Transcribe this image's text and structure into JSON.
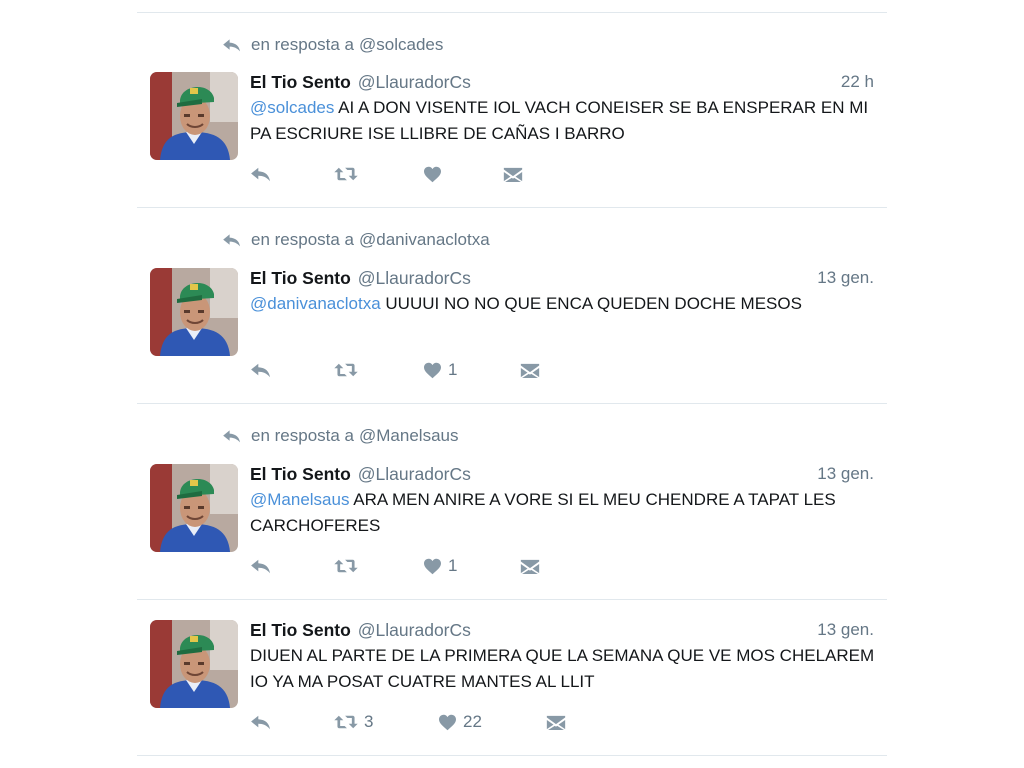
{
  "tweets": [
    {
      "reply_prefix": "en resposta a",
      "reply_handle": "@solcades",
      "name": "El Tio Sento",
      "screen_name": "@LlauradorCs",
      "time": "22 h",
      "mention": "@solcades",
      "text": " AI A DON VISENTE IOL VACH CONEISER SE BA ENSPERAR EN MI PA ESCRIURE ISE LLIBRE DE CAÑAS I BARRO",
      "retweets": "",
      "likes": ""
    },
    {
      "reply_prefix": "en resposta a",
      "reply_handle": "@danivanaclotxa",
      "name": "El Tio Sento",
      "screen_name": "@LlauradorCs",
      "time": "13 gen.",
      "mention": "@danivanaclotxa",
      "text": " UUUUI NO NO QUE ENCA QUEDEN DOCHE MESOS",
      "retweets": "",
      "likes": "1"
    },
    {
      "reply_prefix": "en resposta a",
      "reply_handle": "@Manelsaus",
      "name": "El Tio Sento",
      "screen_name": "@LlauradorCs",
      "time": "13 gen.",
      "mention": "@Manelsaus",
      "text": " ARA MEN ANIRE A VORE SI EL MEU CHENDRE A TAPAT LES CARCHOFERES",
      "retweets": "",
      "likes": "1"
    },
    {
      "name": "El Tio Sento",
      "screen_name": "@LlauradorCs",
      "time": "13 gen.",
      "mention": "",
      "text": "DIUEN AL PARTE DE LA PRIMERA QUE LA SEMANA QUE VE MOS CHELAREM IO YA MA POSAT CUATRE MANTES AL LLIT",
      "retweets": "3",
      "likes": "22"
    }
  ],
  "icons": {
    "reply": "reply-icon",
    "retweet": "retweet-icon",
    "like": "heart-icon",
    "dm": "envelope-icon"
  },
  "colors": {
    "mention": "#4a90d9",
    "secondary": "#657786",
    "divider": "#e1e8ed"
  }
}
